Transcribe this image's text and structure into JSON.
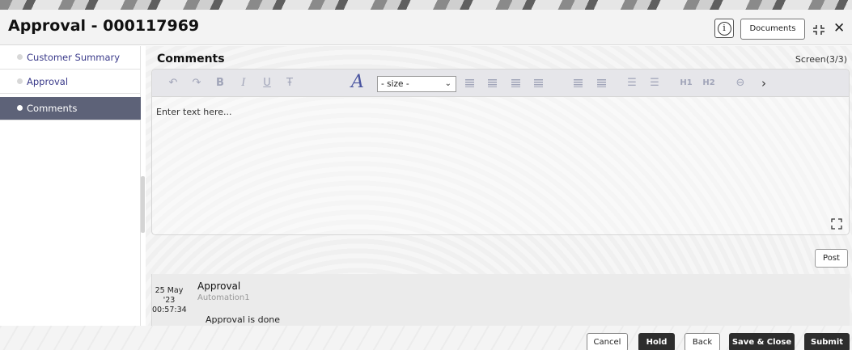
{
  "header": {
    "title": "Approval - 000117969",
    "info_icon": "info-icon",
    "documents_label": "Documents",
    "collapse_icon": "collapse-icon",
    "close_icon": "close-icon"
  },
  "sidebar": {
    "items": [
      {
        "label": "Customer Summary",
        "active": false
      },
      {
        "label": "Approval",
        "active": false
      },
      {
        "label": "Comments",
        "active": true
      }
    ]
  },
  "main": {
    "section_title": "Comments",
    "screen_count": "Screen(3/3)",
    "toolbar": {
      "size_select_value": "- size -",
      "heading1": "H1",
      "heading2": "H2"
    },
    "editor_placeholder": "Enter text here...",
    "post_label": "Post",
    "comment": {
      "date_line1": "25 May",
      "date_line2": "'23",
      "time": "00:57:34",
      "title": "Approval",
      "user": "Automation1",
      "text": "Approval is done"
    }
  },
  "footer": {
    "cancel": "Cancel",
    "hold": "Hold",
    "back": "Back",
    "save_close": "Save & Close",
    "submit": "Submit"
  },
  "colors": {
    "active_nav": "#5d6278",
    "dark_button": "#2d2d2d",
    "toolbar_icon": "#a0a4b8"
  }
}
